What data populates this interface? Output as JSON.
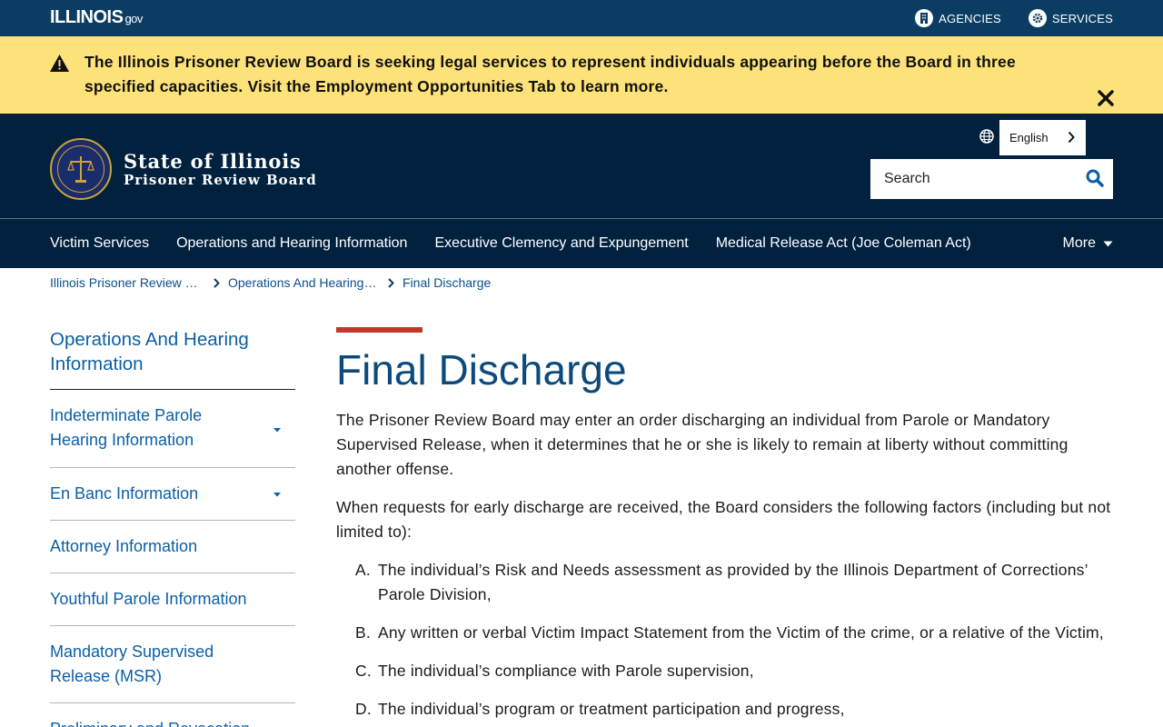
{
  "gov_bar": {
    "logo_text": "ILLINOIS",
    "logo_suffix": "gov",
    "links": [
      {
        "label": "AGENCIES",
        "icon": "building-icon"
      },
      {
        "label": "SERVICES",
        "icon": "gears-icon"
      }
    ]
  },
  "alert": {
    "icon": "warning-icon",
    "text": "The Illinois Prisoner Review Board is seeking legal services to represent individuals appearing before the Board in three specified capacities.  Visit the Employment Opportunities Tab to learn more.",
    "close_icon": "close-icon"
  },
  "header": {
    "title_line1": "State of Illinois",
    "title_line2": "Prisoner Review Board",
    "language": "English",
    "search_placeholder": "Search"
  },
  "nav": {
    "items": [
      "Victim Services",
      "Operations and Hearing Information",
      "Executive Clemency and Expungement",
      "Medical Release Act (Joe Coleman Act)"
    ],
    "more_label": "More"
  },
  "breadcrumb": {
    "items": [
      "Illinois Prisoner Review Board",
      "Operations And Hearing Information",
      "Final Discharge"
    ]
  },
  "sidebar": {
    "title": "Operations And Hearing Information",
    "items": [
      {
        "label": "Indeterminate Parole Hearing Information",
        "has_submenu": true
      },
      {
        "label": "En Banc Information",
        "has_submenu": true
      },
      {
        "label": "Attorney Information",
        "has_submenu": false
      },
      {
        "label": "Youthful Parole Information",
        "has_submenu": false
      },
      {
        "label": "Mandatory Supervised Release (MSR)",
        "has_submenu": false
      },
      {
        "label": "Preliminary and Revocation",
        "has_submenu": false
      }
    ]
  },
  "main": {
    "title": "Final Discharge",
    "paragraphs": [
      "The Prisoner Review Board may enter an order discharging an individual from Parole or Mandatory Supervised Release, when it determines that he or she is likely to remain at liberty without committing another offense.",
      "When requests for early discharge are received, the Board considers the following factors (including but not limited to):"
    ],
    "list": [
      {
        "marker": "A.",
        "text": "The individual’s Risk and Needs assessment as provided by the Illinois Department of Corrections’ Parole Division,"
      },
      {
        "marker": "B.",
        "text": "Any written or verbal Victim Impact Statement from the Victim of the crime, or a relative of the Victim,"
      },
      {
        "marker": "C.",
        "text": "The individual’s compliance with Parole supervision,"
      },
      {
        "marker": "D.",
        "text": "The individual’s program or treatment participation and progress,"
      }
    ]
  },
  "colors": {
    "gov_bar": "#0b3d62",
    "alert_bg": "#fde27a",
    "header_bg": "#01213f",
    "link": "#0b5fa6",
    "title": "#0d4a7c",
    "accent_bar": "#c0392b"
  }
}
